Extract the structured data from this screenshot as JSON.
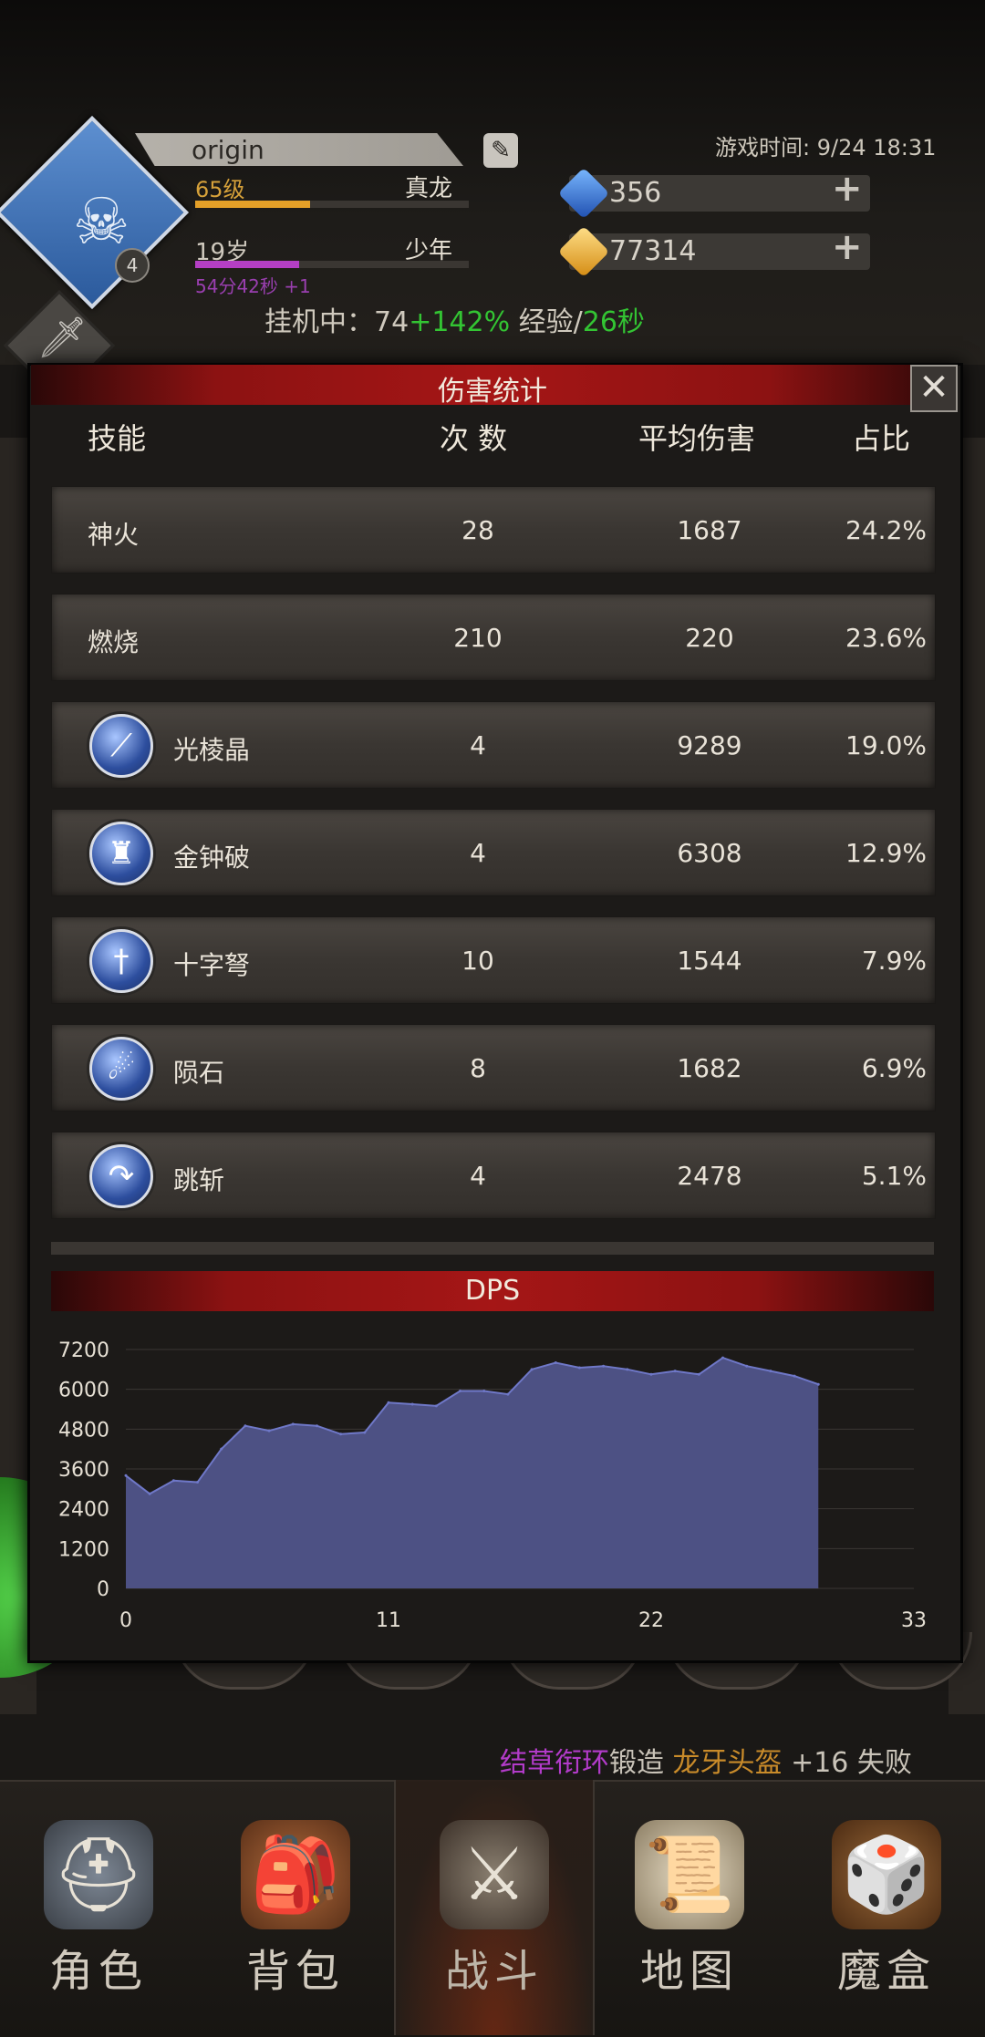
{
  "header": {
    "player_name": "origin",
    "level": "65级",
    "title_rank": "真龙",
    "age": "19岁",
    "age_stage": "少年",
    "age_timer": "54分42秒 +1",
    "emblem_level": "4",
    "xp_progress": 0.42,
    "age_progress": 0.38,
    "game_time": "游戏时间: 9/24 18:31",
    "gems": "356",
    "gold": "77314",
    "idle_prefix": "挂机中：74",
    "idle_bonus": "+142%",
    "idle_exp": " 经验/",
    "idle_secs": "26秒"
  },
  "modal": {
    "title": "伤害统计",
    "close_label": "✕",
    "columns": {
      "skill": "技能",
      "count": "次 数",
      "avg": "平均伤害",
      "ratio": "占比"
    },
    "rows": [
      {
        "name": "神火",
        "count": "28",
        "avg": "1687",
        "ratio": "24.2%",
        "icon": ""
      },
      {
        "name": "燃烧",
        "count": "210",
        "avg": "220",
        "ratio": "23.6%",
        "icon": ""
      },
      {
        "name": "光棱晶",
        "count": "4",
        "avg": "9289",
        "ratio": "19.0%",
        "icon": "prism-beam-icon"
      },
      {
        "name": "金钟破",
        "count": "4",
        "avg": "6308",
        "ratio": "12.9%",
        "icon": "golden-bell-icon"
      },
      {
        "name": "十字弩",
        "count": "10",
        "avg": "1544",
        "ratio": "7.9%",
        "icon": "crossbow-sword-icon"
      },
      {
        "name": "陨石",
        "count": "8",
        "avg": "1682",
        "ratio": "6.9%",
        "icon": "meteor-icon"
      },
      {
        "name": "跳斩",
        "count": "4",
        "avg": "2478",
        "ratio": "5.1%",
        "icon": "leap-slash-icon"
      }
    ],
    "dps_title": "DPS"
  },
  "chart_data": {
    "type": "area",
    "title": "DPS",
    "xlabel": "",
    "ylabel": "",
    "x_ticks": [
      0,
      11,
      22,
      33
    ],
    "y_ticks": [
      0,
      1200,
      2400,
      3600,
      4800,
      6000,
      7200
    ],
    "xlim": [
      0,
      33
    ],
    "ylim": [
      0,
      7200
    ],
    "x": [
      0,
      1,
      2,
      3,
      4,
      5,
      6,
      7,
      8,
      9,
      10,
      11,
      12,
      13,
      14,
      15,
      16,
      17,
      18,
      19,
      20,
      21,
      22,
      23,
      24,
      25,
      26,
      27,
      28,
      29
    ],
    "values": [
      3400,
      2850,
      3250,
      3200,
      4200,
      4900,
      4750,
      4950,
      4900,
      4650,
      4700,
      5600,
      5550,
      5500,
      5950,
      5950,
      5850,
      6600,
      6800,
      6650,
      6700,
      6600,
      6450,
      6550,
      6450,
      6950,
      6700,
      6550,
      6400,
      6150
    ],
    "fill_color": "#4d5184",
    "line_color": "#6f78c8",
    "grid": true
  },
  "ticker": {
    "part1": "结草衔环",
    "part2": "锻造 ",
    "part3": "龙牙头盔",
    "part4": " +16 失败"
  },
  "nav": [
    {
      "label": "角色",
      "icon": "helmet-icon"
    },
    {
      "label": "背包",
      "icon": "backpack-icon"
    },
    {
      "label": "战斗",
      "icon": "sword-shield-icon"
    },
    {
      "label": "地图",
      "icon": "scroll-map-icon"
    },
    {
      "label": "魔盒",
      "icon": "magic-box-icon"
    }
  ]
}
